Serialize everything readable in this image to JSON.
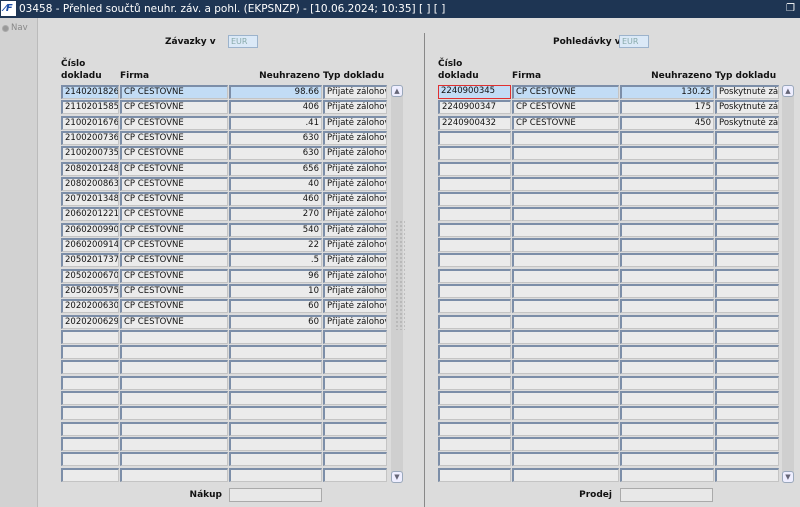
{
  "window": {
    "title": "03458 - Přehled součtů neuhr. záv. a pohl. (EKPSNZP) - [10.06.2024; 10:35]  [ ] [ ]",
    "logo": "IF"
  },
  "nav": {
    "label": "Nav"
  },
  "left": {
    "heading": "Závazky v",
    "currency": "EUR",
    "columns": [
      "Číslo\ndokladu",
      "Firma",
      "Neuhrazeno",
      "Typ dokladu"
    ],
    "rows": [
      [
        "2140201826",
        "CP CESTOVNE",
        "98.66",
        "Přijaté zálohové"
      ],
      [
        "2110201585",
        "CP CESTOVNE",
        "406",
        "Přijaté zálohové"
      ],
      [
        "2100201676",
        "CP CESTOVNE",
        ".41",
        "Přijaté zálohové"
      ],
      [
        "2100200736",
        "CP CESTOVNE",
        "630",
        "Přijaté zálohové"
      ],
      [
        "2100200735",
        "CP CESTOVNE",
        "630",
        "Přijaté zálohové"
      ],
      [
        "2080201248",
        "CP CESTOVNE",
        "656",
        "Přijaté zálohové"
      ],
      [
        "2080200863",
        "CP CESTOVNE",
        "40",
        "Přijaté zálohové"
      ],
      [
        "2070201348",
        "CP CESTOVNE",
        "460",
        "Přijaté zálohové"
      ],
      [
        "2060201221",
        "CP CESTOVNE",
        "270",
        "Přijaté zálohové"
      ],
      [
        "2060200990",
        "CP CESTOVNE",
        "540",
        "Přijaté zálohové"
      ],
      [
        "2060200914",
        "CP CESTOVNE",
        "22",
        "Přijaté zálohové"
      ],
      [
        "2050201737",
        "CP CESTOVNE",
        ".5",
        "Přijaté zálohové"
      ],
      [
        "2050200670",
        "CP CESTOVNE",
        "96",
        "Přijaté zálohové"
      ],
      [
        "2050200575",
        "CP CESTOVNE",
        "10",
        "Přijaté zálohové"
      ],
      [
        "2020200630",
        "CP CESTOVNE",
        "60",
        "Přijaté zálohové"
      ],
      [
        "2020200629",
        "CP CESTOVNE",
        "60",
        "Přijaté zálohové"
      ]
    ],
    "total_label": "Nákup",
    "total_value": ""
  },
  "right": {
    "heading": "Pohledávky v",
    "currency": "EUR",
    "columns": [
      "Číslo\ndokladu",
      "Firma",
      "Neuhrazeno",
      "Typ dokladu"
    ],
    "rows": [
      [
        "2240900345",
        "CP CESTOVNE",
        "130.25",
        "Poskytnuté zálo"
      ],
      [
        "2240900347",
        "CP CESTOVNE",
        "175",
        "Poskytnuté zálo"
      ],
      [
        "2240900432",
        "CP CESTOVNE",
        "450",
        "Poskytnuté zálo"
      ]
    ],
    "total_label": "Prodej",
    "total_value": ""
  }
}
